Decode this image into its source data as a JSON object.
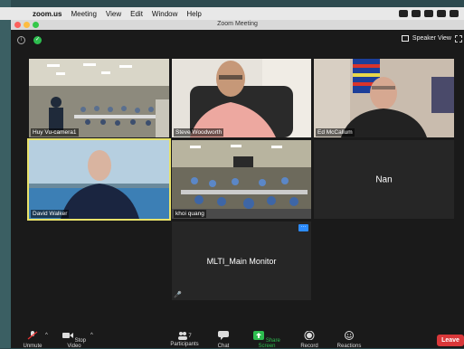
{
  "menubar": {
    "app_name": "zoom.us",
    "items": [
      "Meeting",
      "View",
      "Edit",
      "Window",
      "Help"
    ]
  },
  "window": {
    "title": "Zoom Meeting"
  },
  "topbar": {
    "view_label": "Speaker View"
  },
  "participants": [
    {
      "name": "Huy Vu-camera1"
    },
    {
      "name": "Steve Woodworth"
    },
    {
      "name": "Ed McCallum"
    },
    {
      "name": "David Walker"
    },
    {
      "name": "khoi quang"
    },
    {
      "name": "Nan"
    },
    {
      "name": "MLTI_Main Monitor"
    }
  ],
  "toolbar": {
    "mute": "Unmute",
    "video": "Stop Video",
    "participants": "Participants",
    "participants_count": "7",
    "chat": "Chat",
    "share": "Share Screen",
    "record": "Record",
    "reactions": "Reactions",
    "leave": "Leave"
  },
  "colors": {
    "active_speaker": "#e9e36a",
    "share": "#2dbd4f",
    "leave": "#d9383a",
    "accent": "#2d8cff"
  }
}
